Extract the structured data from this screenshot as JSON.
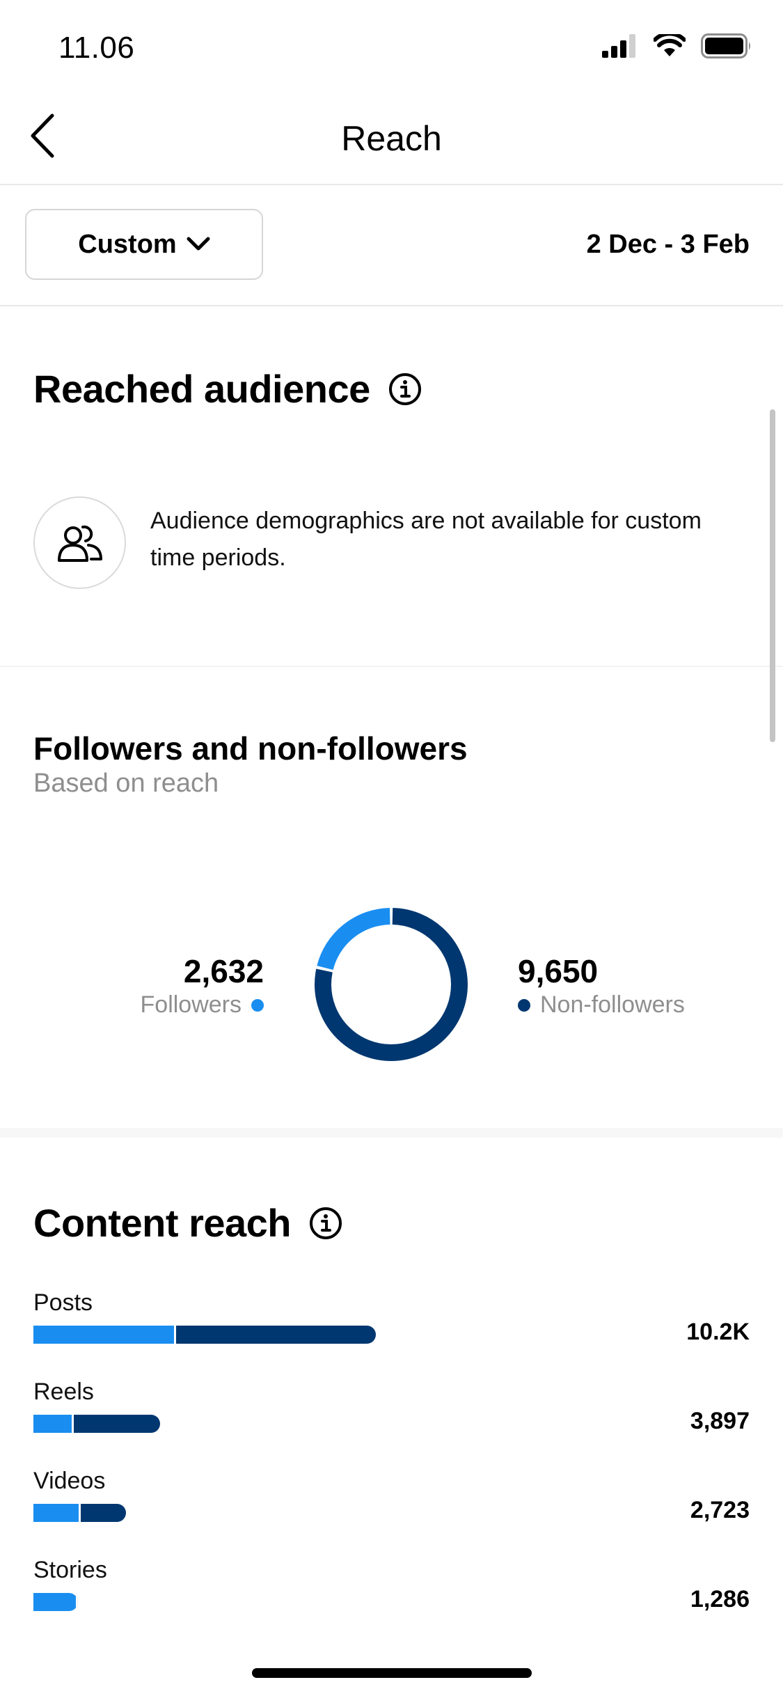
{
  "status_bar": {
    "time": "11.06"
  },
  "nav": {
    "title": "Reach"
  },
  "filter": {
    "period_label": "Custom",
    "date_range": "2 Dec - 3 Feb"
  },
  "reached_audience": {
    "title": "Reached audience",
    "message": "Audience demographics are not available for custom time periods."
  },
  "followers_section": {
    "title": "Followers and non-followers",
    "caption": "Based on reach",
    "followers": {
      "value": "2,632",
      "label": "Followers",
      "color": "#1a8ef0"
    },
    "non_followers": {
      "value": "9,650",
      "label": "Non-followers",
      "color": "#003770"
    }
  },
  "content_reach": {
    "title": "Content reach",
    "colors": {
      "followers": "#1a8ef0",
      "non_followers": "#003770"
    },
    "items": [
      {
        "label": "Posts",
        "value": "10.2K",
        "followers_share": 0.41,
        "total_fraction": 1.0
      },
      {
        "label": "Reels",
        "value": "3,897",
        "followers_share": 0.3,
        "total_fraction": 0.37
      },
      {
        "label": "Videos",
        "value": "2,723",
        "followers_share": 0.49,
        "total_fraction": 0.27
      },
      {
        "label": "Stories",
        "value": "1,286",
        "followers_share": 0.95,
        "total_fraction": 0.13
      }
    ]
  }
}
